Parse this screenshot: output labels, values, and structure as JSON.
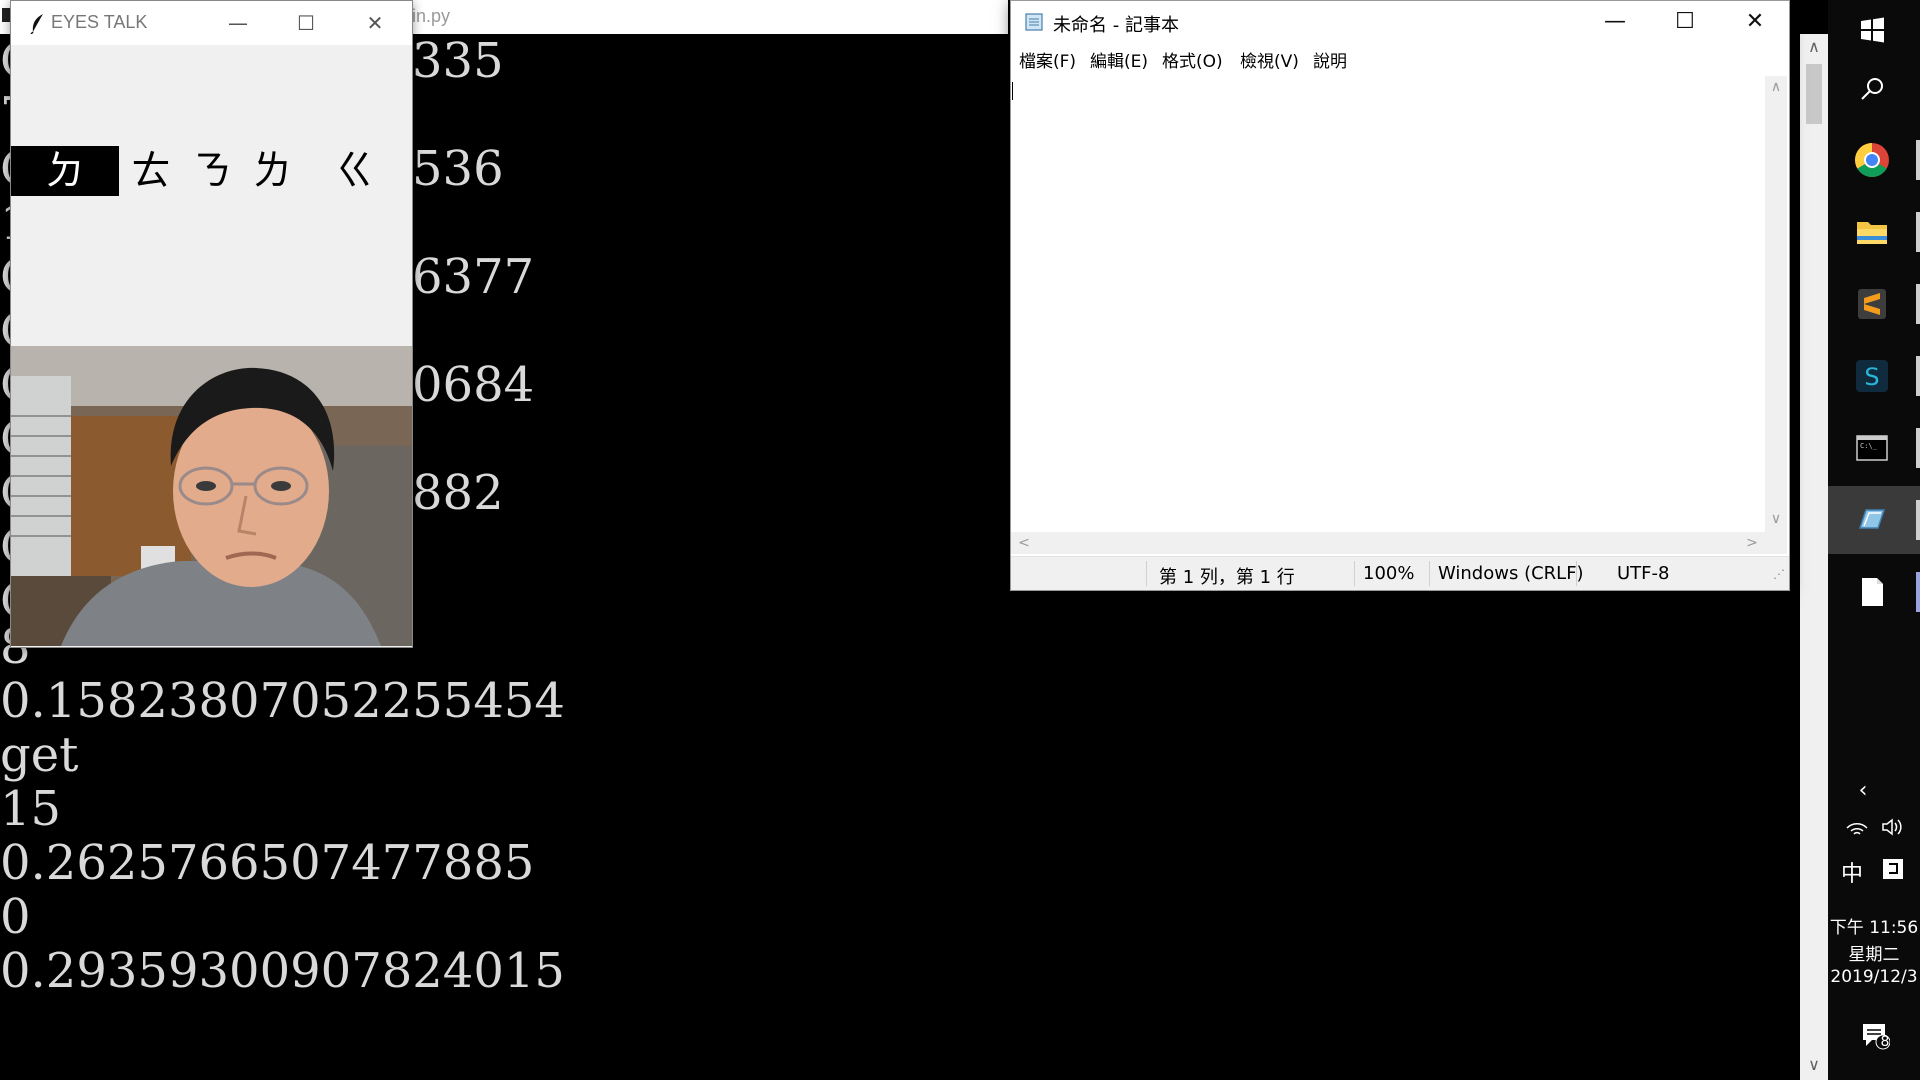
{
  "console": {
    "title": "in.py",
    "partial_lines": [
      {
        "left": "C",
        "right": "335"
      },
      {
        "left": "7",
        "right": ""
      },
      {
        "left": "C",
        "right": "536"
      },
      {
        "left": "1",
        "right": ""
      },
      {
        "left": "C",
        "right": "6377"
      },
      {
        "left": "C",
        "right": ""
      },
      {
        "left": "C",
        "right": "0684"
      },
      {
        "left": "C",
        "right": ""
      },
      {
        "left": "C",
        "right": "882"
      },
      {
        "left": "C",
        "right": ""
      },
      {
        "left": "C",
        "right": ""
      }
    ],
    "lines": [
      "8",
      "0.15823807052255454",
      "get",
      "15",
      "0.2625766507477885",
      "0",
      "0.29359300907824015"
    ]
  },
  "eyes_talk": {
    "title": "EYES TALK",
    "letters": [
      "ㄉ",
      "ㄊ",
      "ㄋ",
      "ㄌ",
      "ㄍ"
    ],
    "selected_index": 0
  },
  "notepad": {
    "title": "未命名 - 記事本",
    "menu": [
      "檔案(F)",
      "編輯(E)",
      "格式(O)",
      "檢視(V)",
      "說明"
    ],
    "status": {
      "position": "第 1 列，第 1 行",
      "zoom": "100%",
      "line_ending": "Windows (CRLF)",
      "encoding": "UTF-8"
    }
  },
  "taskbar": {
    "apps": [
      "windows-start-icon",
      "search-icon",
      "chrome-icon",
      "file-explorer-icon",
      "sublime-text-icon",
      "app-s-icon",
      "terminal-icon",
      "python-idle-icon",
      "notepad-icon"
    ],
    "ime": "中",
    "clock": {
      "time": "下午 11:56",
      "weekday": "星期二",
      "date": "2019/12/3"
    },
    "notification_count": "8"
  }
}
